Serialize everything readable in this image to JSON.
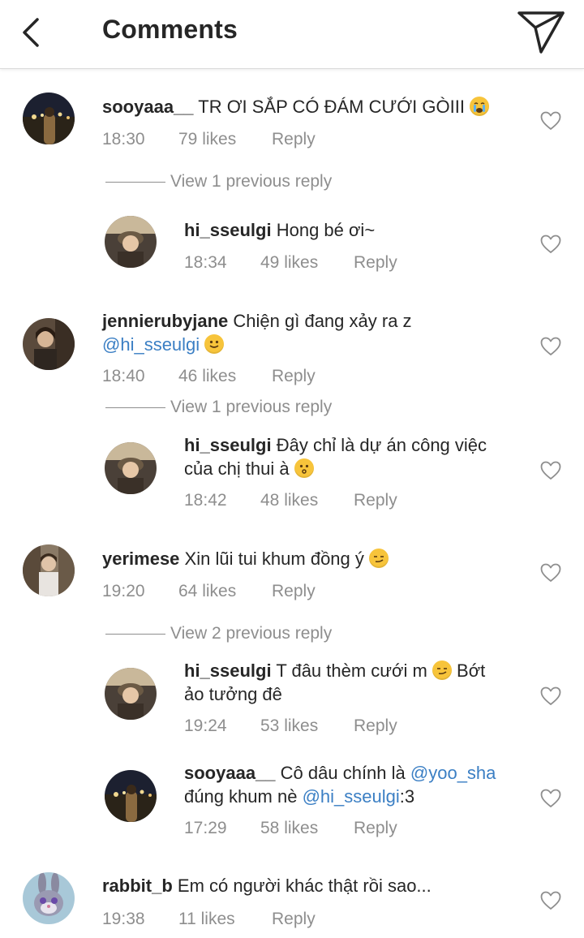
{
  "header": {
    "title": "Comments"
  },
  "comments": [
    {
      "username": "sooyaaa__",
      "text": "TR ƠI SẮP CÓ ĐÁM CƯỚI GÒIII",
      "emoji": "crying-face-emoji",
      "time": "18:30",
      "likes": "79 likes",
      "reply": "Reply",
      "view_prev": "View 1 previous reply"
    },
    {
      "username": "hi_sseulgi",
      "text": "Hong bé ơi~",
      "time": "18:34",
      "likes": "49 likes",
      "reply": "Reply"
    },
    {
      "username": "jennierubyjane",
      "text": "Chiện gì đang xảy ra z",
      "mention": "@hi_sseulgi",
      "emoji": "slight-smile-emoji",
      "time": "18:40",
      "likes": "46 likes",
      "reply": "Reply",
      "view_prev": "View 1 previous reply"
    },
    {
      "username": "hi_sseulgi",
      "text": "Đây chỉ là dự án công việc",
      "text2": "của chị thui à",
      "emoji": "kissing-face-emoji",
      "time": "18:42",
      "likes": "48 likes",
      "reply": "Reply"
    },
    {
      "username": "yerimese",
      "text": "Xin lũi tui khum đồng ý",
      "emoji": "smirking-face-emoji",
      "time": "19:20",
      "likes": "64 likes",
      "reply": "Reply",
      "view_prev": "View 2 previous reply"
    },
    {
      "username": "hi_sseulgi",
      "text": "T đâu thèm cưới m",
      "emoji": "smirking-face-emoji",
      "text_after": "Bớt",
      "text2": "ảo tưởng đê",
      "time": "19:24",
      "likes": "53 likes",
      "reply": "Reply"
    },
    {
      "username": "sooyaaa__",
      "text": "Cô dâu chính là",
      "mention": "@yoo_sha",
      "text2": "đúng khum nè",
      "mention2": "@hi_sseulgi",
      "text2_after": ":3",
      "time": "17:29",
      "likes": "58 likes",
      "reply": "Reply"
    },
    {
      "username": "rabbit_b",
      "text": "Em có người khác thật rồi sao...",
      "time": "19:38",
      "likes": "11 likes",
      "reply": "Reply"
    }
  ]
}
